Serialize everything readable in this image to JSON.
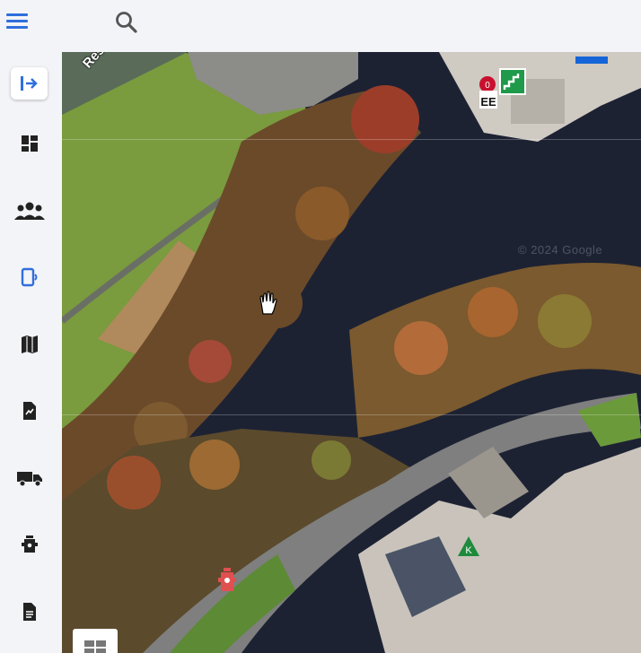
{
  "topbar": {
    "menu_icon": "hamburger-menu-icon",
    "search_icon": "search-icon"
  },
  "sidebar": {
    "items": [
      {
        "id": "collapse",
        "icon": "sidebar-toggle-icon",
        "active": true
      },
      {
        "id": "dashboard",
        "icon": "dashboard-icon"
      },
      {
        "id": "groups",
        "icon": "groups-icon"
      },
      {
        "id": "devices",
        "icon": "device-icon"
      },
      {
        "id": "map",
        "icon": "map-icon"
      },
      {
        "id": "reports",
        "icon": "report-icon"
      },
      {
        "id": "vehicles",
        "icon": "truck-icon"
      },
      {
        "id": "hydrants",
        "icon": "fire-hydrant-icon"
      },
      {
        "id": "documents",
        "icon": "document-icon"
      }
    ]
  },
  "map": {
    "street_label": "Restor",
    "copyright": "© 2024 Google",
    "markers": {
      "red_badge": "0",
      "green_k": "K"
    }
  },
  "colors": {
    "accent": "#2f6fdc",
    "sidebar_bg": "#f3f4f8",
    "hydrant": "#d94848",
    "green_marker": "#1e8a3c"
  }
}
